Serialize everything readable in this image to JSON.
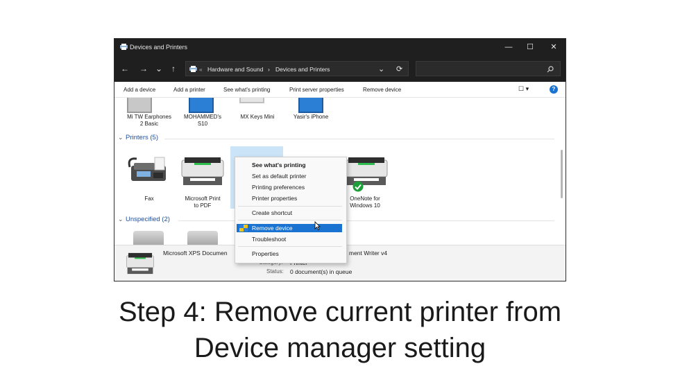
{
  "window": {
    "title": "Devices and Printers"
  },
  "window_controls": {
    "minimize": "—",
    "maximize": "☐",
    "close": "✕"
  },
  "nav": {
    "back": "←",
    "forward": "→",
    "recent": "⌄",
    "up": "↑"
  },
  "address": {
    "overflow": "«",
    "crumb1": "Hardware and Sound",
    "separator": "›",
    "crumb2": "Devices and Printers",
    "dropdown": "⌄",
    "refresh": "⟳"
  },
  "command_bar": {
    "items": [
      "Add a device",
      "Add a printer",
      "See what's printing",
      "Print server properties",
      "Remove device"
    ],
    "view": "☐ ▾",
    "help": "?"
  },
  "devices": [
    {
      "label": "Mi TW Earphones\n2 Basic"
    },
    {
      "label": "MOHAMMED's\nS10"
    },
    {
      "label": "MX Keys Mini"
    },
    {
      "label": "Yasir's iPhone"
    }
  ],
  "groups": {
    "printers": "Printers (5)",
    "unspecified": "Unspecified (2)"
  },
  "printers": [
    {
      "label": "Fax"
    },
    {
      "label": "Microsoft Print\nto PDF"
    },
    {
      "label": "OneNote for\nWindows 10"
    }
  ],
  "context_menu": {
    "items": [
      "See what's printing",
      "Set as default printer",
      "Printing preferences",
      "Printer properties",
      "Create shortcut",
      "Remove device",
      "Troubleshoot",
      "Properties"
    ],
    "highlight_color": "#1a73d1"
  },
  "details": {
    "name_left": "Microsoft XPS Documen",
    "name_right": "ment Writer v4",
    "category_label": "Category:",
    "category_value": "Printer",
    "status_label": "Status:",
    "status_value": "0 document(s) in queue"
  },
  "caption": {
    "line1": "Step 4: Remove current printer from",
    "line2": "Device manager setting"
  }
}
